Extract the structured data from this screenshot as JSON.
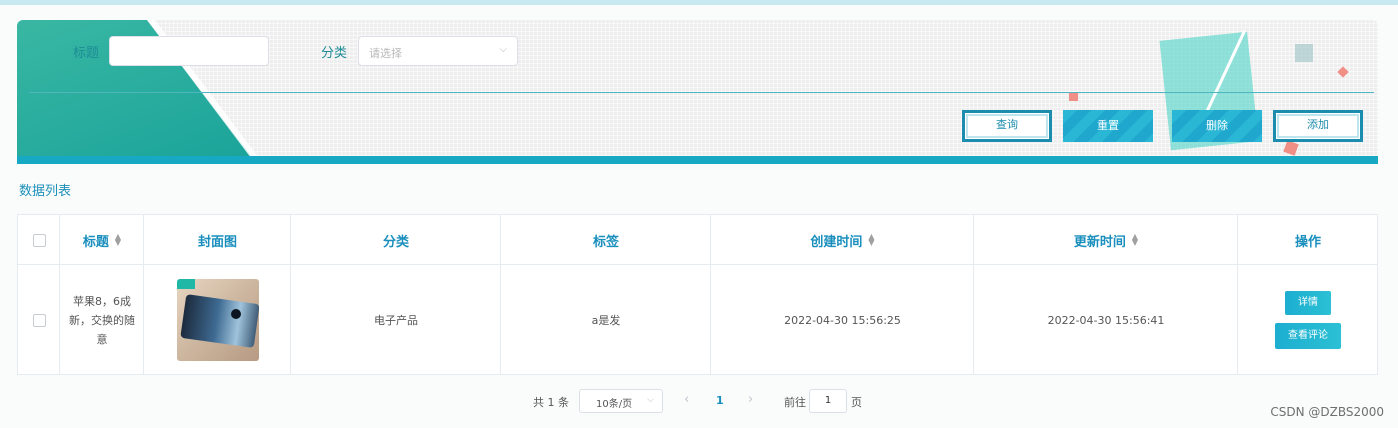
{
  "search": {
    "title_label": "标题",
    "category_label": "分类",
    "category_placeholder": "请选择",
    "buttons": {
      "query": "查询",
      "reset": "重置",
      "delete": "删除",
      "add": "添加"
    }
  },
  "list": {
    "title": "数据列表"
  },
  "table": {
    "headers": {
      "title": "标题",
      "cover": "封面图",
      "category": "分类",
      "tags": "标签",
      "created": "创建时间",
      "updated": "更新时间",
      "actions": "操作"
    },
    "rows": [
      {
        "title": "苹果8，6成新，交换的随意",
        "category": "电子产品",
        "tags": "a是发",
        "created": "2022-04-30 15:56:25",
        "updated": "2022-04-30 15:56:41",
        "detail": "详情",
        "comment": "查看评论"
      }
    ]
  },
  "pagination": {
    "total": "共 1 条",
    "page_size": "10条/页",
    "prev": "‹",
    "current": "1",
    "next": "›",
    "goto_label": "前往",
    "goto_value": "1",
    "page_suffix": "页"
  },
  "watermark": "CSDN @DZBS2000",
  "colors": {
    "accent": "#1a8fbd",
    "teal": "#1aa39a",
    "button": "#1fa7cd"
  }
}
